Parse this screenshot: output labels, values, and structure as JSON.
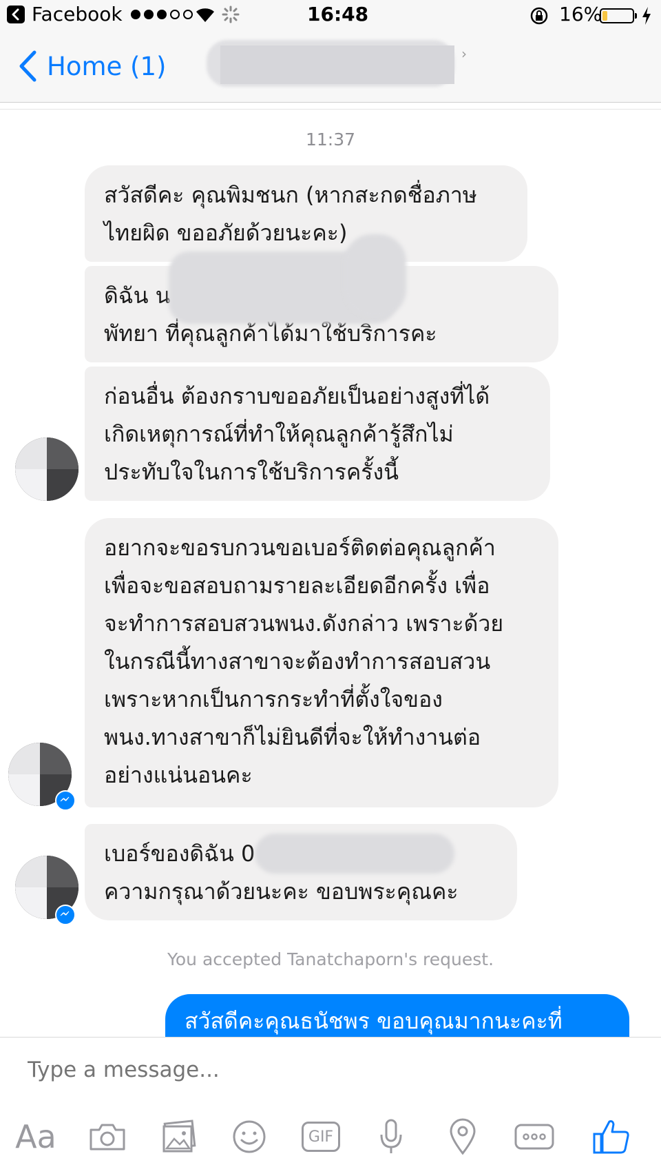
{
  "status_bar": {
    "app_name": "Facebook",
    "time": "16:48",
    "battery_percent": "16%",
    "battery_level": 0.16,
    "signal_bars_on": 3,
    "signal_bars_total": 5
  },
  "nav": {
    "back_label": "Home (1)"
  },
  "conversation": {
    "timestamp": "11:37",
    "messages": [
      {
        "text": "สวัสดีคะ คุณพิมชนก (หากสะกดชื่อภาษ\nไทยผิด ขออภัยด้วยนะคะ)"
      },
      {
        "text": "ดิฉัน น                                   เป็นผจก.สาขา\nพัทยา ที่คุณลูกค้าได้มาใช้บริการคะ"
      },
      {
        "text": "ก่อนอื่น ต้องกราบขออภัยเป็นอย่างสูงที่ได้\nเกิดเหตุการณ์ที่ทำให้คุณลูกค้ารู้สึกไม่\nประทับใจในการใช้บริการครั้งนี้"
      },
      {
        "text": "อยากจะขอรบกวนขอเบอร์ติดต่อคุณลูกค้า\nเพื่อจะขอสอบถามรายละเอียดอีกครั้ง เพื่อ\nจะทำการสอบสวนพนง.ดังกล่าว เพราะด้วย\nในกรณีนี้ทางสาขาจะต้องทำการสอบสวน\nเพราะหากเป็นการกระทำที่ตั้งใจของ\nพนง.ทางสาขาก็ไม่ยินดีที่จะให้ทำงานต่อ\nอย่างแน่นอนคะ"
      },
      {
        "text": "เบอร์ของดิฉัน 0                          ะ ขอ\nความกรุณาด้วยนะคะ  ขอบพระคุณคะ"
      }
    ],
    "system_note": "You accepted Tanatchaporn's request.",
    "my_message": "สวัสดีคะคุณธนัชพร ขอบคุณมากนะคะที่"
  },
  "composer": {
    "placeholder": "Type a message...",
    "aa_label": "Aa",
    "gif_label": "GIF"
  },
  "colors": {
    "accent": "#0a7cff",
    "my_bubble": "#0084ff",
    "their_bubble": "#f1f0f0",
    "battery_fill": "#f6c544"
  },
  "icons": [
    "back-icon",
    "wifi-icon",
    "activity-spinner-icon",
    "orientation-lock-icon",
    "battery-icon",
    "charging-bolt-icon",
    "chevron-left-icon",
    "messenger-badge-icon",
    "camera-icon",
    "photo-icon",
    "emoji-icon",
    "gif-icon",
    "microphone-icon",
    "location-pin-icon",
    "more-icon",
    "thumbs-up-icon"
  ]
}
